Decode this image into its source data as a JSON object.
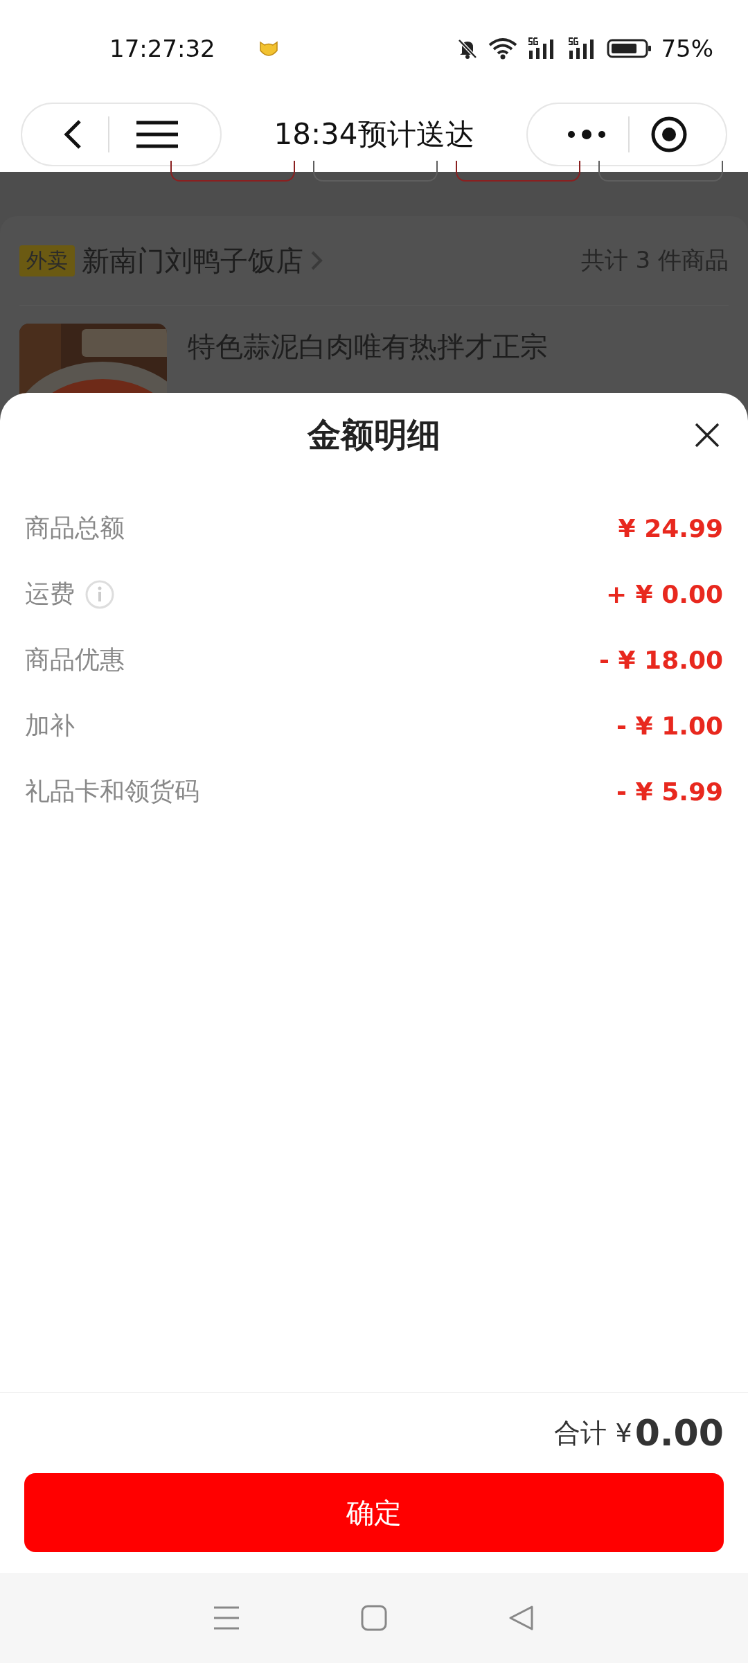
{
  "status_bar": {
    "time": "17:27:32",
    "battery": "75%"
  },
  "header": {
    "title": "18:34预计送达"
  },
  "background": {
    "buttons": [
      {
        "color": "#8a2020"
      },
      {
        "color": "#5e5e5e"
      },
      {
        "color": "#8a2020"
      },
      {
        "color": "#5e5e5e"
      }
    ],
    "shop": {
      "tag": "外卖",
      "name": "新南门刘鸭子饭店",
      "count": "共计 3 件商品"
    },
    "item": {
      "name": "特色蒜泥白肉唯有热拌才正宗"
    }
  },
  "sheet": {
    "title": "金额明细",
    "rows": [
      {
        "label": "商品总额",
        "info": false,
        "value": "¥ 24.99"
      },
      {
        "label": "运费",
        "info": true,
        "value": "+ ¥ 0.00"
      },
      {
        "label": "商品优惠",
        "info": false,
        "value": "- ¥ 18.00"
      },
      {
        "label": "加补",
        "info": false,
        "value": "- ¥ 1.00"
      },
      {
        "label": "礼品卡和领货码",
        "info": false,
        "value": "- ¥ 5.99"
      }
    ],
    "total_label": "合计 ¥",
    "total": "0.00",
    "confirm": "确定"
  }
}
